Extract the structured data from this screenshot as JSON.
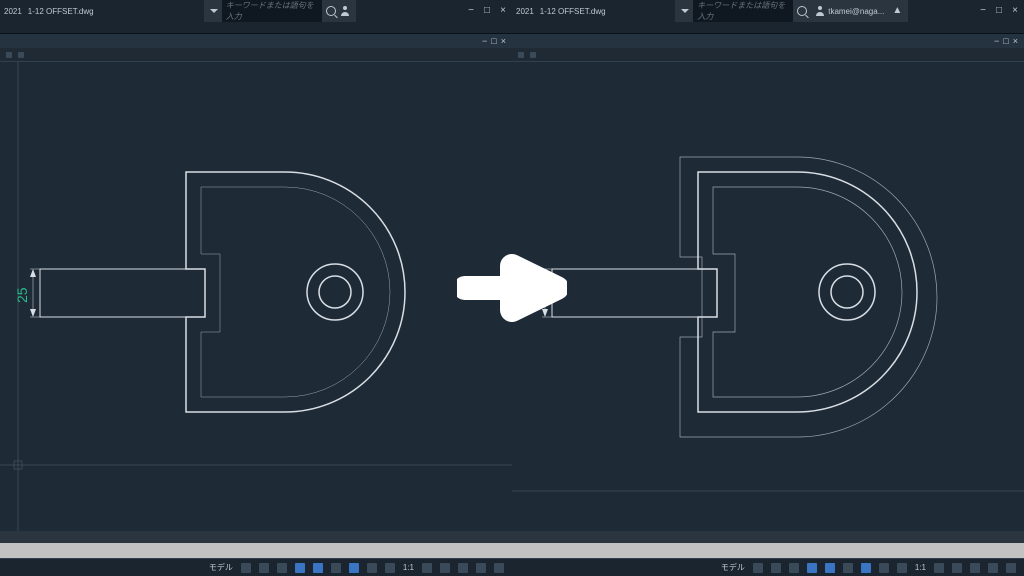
{
  "title_year": "2021",
  "filename": "1-12 OFFSET.dwg",
  "search_placeholder": "キーワードまたは語句を入力",
  "username": "tkamei@naga...",
  "dimension_value": "25",
  "status": {
    "model_label": "モデル",
    "scale": "1:1"
  }
}
